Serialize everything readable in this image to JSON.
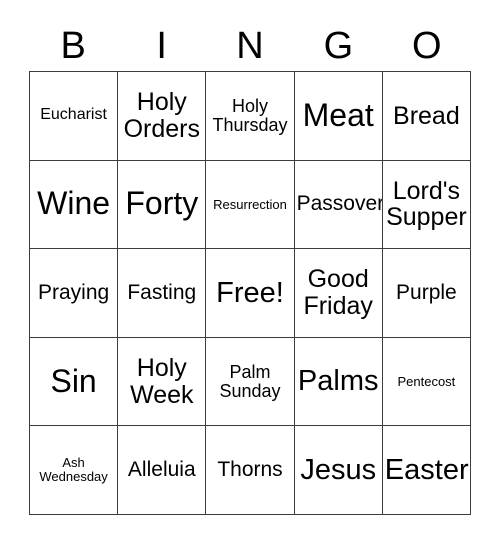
{
  "card": {
    "header_letters": [
      "B",
      "I",
      "N",
      "G",
      "O"
    ],
    "grid_size": "5x5",
    "colors": {
      "background": "#ffffff",
      "text": "#000000",
      "border": "#3d3d3d"
    },
    "rows": [
      [
        {
          "label": "Eucharist",
          "size": "xs"
        },
        {
          "label": "Holy\nOrders",
          "size": "lg"
        },
        {
          "label": "Holy\nThursday",
          "size": "sm"
        },
        {
          "label": "Meat",
          "size": "xxl"
        },
        {
          "label": "Bread",
          "size": "lg"
        }
      ],
      [
        {
          "label": "Wine",
          "size": "xxl"
        },
        {
          "label": "Forty",
          "size": "xxl"
        },
        {
          "label": "Resurrection",
          "size": "xxs"
        },
        {
          "label": "Passover",
          "size": "md"
        },
        {
          "label": "Lord's\nSupper",
          "size": "lg"
        }
      ],
      [
        {
          "label": "Praying",
          "size": "md"
        },
        {
          "label": "Fasting",
          "size": "md"
        },
        {
          "label": "Free!",
          "size": "xl"
        },
        {
          "label": "Good\nFriday",
          "size": "lg"
        },
        {
          "label": "Purple",
          "size": "md"
        }
      ],
      [
        {
          "label": "Sin",
          "size": "xxl"
        },
        {
          "label": "Holy\nWeek",
          "size": "lg"
        },
        {
          "label": "Palm\nSunday",
          "size": "sm"
        },
        {
          "label": "Palms",
          "size": "xl"
        },
        {
          "label": "Pentecost",
          "size": "xxs"
        }
      ],
      [
        {
          "label": "Ash\nWednesday",
          "size": "xxs"
        },
        {
          "label": "Alleluia",
          "size": "md"
        },
        {
          "label": "Thorns",
          "size": "md"
        },
        {
          "label": "Jesus",
          "size": "xl"
        },
        {
          "label": "Easter",
          "size": "xl"
        }
      ]
    ]
  }
}
